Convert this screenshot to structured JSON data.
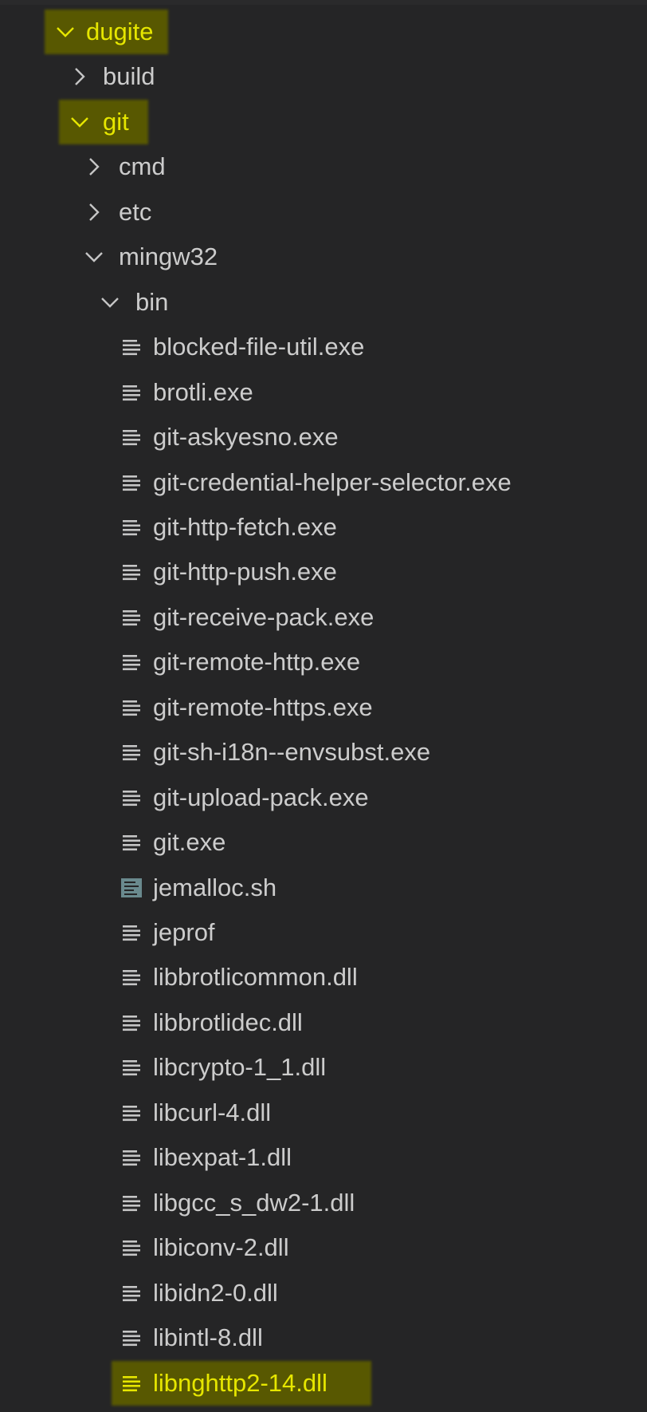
{
  "explorer": {
    "colors": {
      "background": "#252526",
      "text": "#cccccc",
      "highlight": "#5b5b00",
      "highlight_text": "#e6e600",
      "icon": "#c5c5c5",
      "script_icon": "#6a8a8e"
    },
    "tree": [
      {
        "label": "dugite",
        "type": "folder",
        "state": "expanded",
        "highlighted": true
      },
      {
        "label": "build",
        "type": "folder",
        "state": "collapsed",
        "highlighted": false
      },
      {
        "label": "git",
        "type": "folder",
        "state": "expanded",
        "highlighted": true
      },
      {
        "label": "cmd",
        "type": "folder",
        "state": "collapsed",
        "highlighted": false
      },
      {
        "label": "etc",
        "type": "folder",
        "state": "collapsed",
        "highlighted": false
      },
      {
        "label": "mingw32",
        "type": "folder",
        "state": "expanded",
        "highlighted": false
      },
      {
        "label": "bin",
        "type": "folder",
        "state": "expanded",
        "highlighted": false
      },
      {
        "label": "blocked-file-util.exe",
        "type": "file",
        "icon": "lines-file-icon",
        "highlighted": false
      },
      {
        "label": "brotli.exe",
        "type": "file",
        "icon": "lines-file-icon",
        "highlighted": false
      },
      {
        "label": "git-askyesno.exe",
        "type": "file",
        "icon": "lines-file-icon",
        "highlighted": false
      },
      {
        "label": "git-credential-helper-selector.exe",
        "type": "file",
        "icon": "lines-file-icon",
        "highlighted": false
      },
      {
        "label": "git-http-fetch.exe",
        "type": "file",
        "icon": "lines-file-icon",
        "highlighted": false
      },
      {
        "label": "git-http-push.exe",
        "type": "file",
        "icon": "lines-file-icon",
        "highlighted": false
      },
      {
        "label": "git-receive-pack.exe",
        "type": "file",
        "icon": "lines-file-icon",
        "highlighted": false
      },
      {
        "label": "git-remote-http.exe",
        "type": "file",
        "icon": "lines-file-icon",
        "highlighted": false
      },
      {
        "label": "git-remote-https.exe",
        "type": "file",
        "icon": "lines-file-icon",
        "highlighted": false
      },
      {
        "label": "git-sh-i18n--envsubst.exe",
        "type": "file",
        "icon": "lines-file-icon",
        "highlighted": false
      },
      {
        "label": "git-upload-pack.exe",
        "type": "file",
        "icon": "lines-file-icon",
        "highlighted": false
      },
      {
        "label": "git.exe",
        "type": "file",
        "icon": "lines-file-icon",
        "highlighted": false
      },
      {
        "label": "jemalloc.sh",
        "type": "file",
        "icon": "shell-script-icon",
        "highlighted": false
      },
      {
        "label": "jeprof",
        "type": "file",
        "icon": "lines-file-icon",
        "highlighted": false
      },
      {
        "label": "libbrotlicommon.dll",
        "type": "file",
        "icon": "lines-file-icon",
        "highlighted": false
      },
      {
        "label": "libbrotlidec.dll",
        "type": "file",
        "icon": "lines-file-icon",
        "highlighted": false
      },
      {
        "label": "libcrypto-1_1.dll",
        "type": "file",
        "icon": "lines-file-icon",
        "highlighted": false
      },
      {
        "label": "libcurl-4.dll",
        "type": "file",
        "icon": "lines-file-icon",
        "highlighted": false
      },
      {
        "label": "libexpat-1.dll",
        "type": "file",
        "icon": "lines-file-icon",
        "highlighted": false
      },
      {
        "label": "libgcc_s_dw2-1.dll",
        "type": "file",
        "icon": "lines-file-icon",
        "highlighted": false
      },
      {
        "label": "libiconv-2.dll",
        "type": "file",
        "icon": "lines-file-icon",
        "highlighted": false
      },
      {
        "label": "libidn2-0.dll",
        "type": "file",
        "icon": "lines-file-icon",
        "highlighted": false
      },
      {
        "label": "libintl-8.dll",
        "type": "file",
        "icon": "lines-file-icon",
        "highlighted": false
      },
      {
        "label": "libnghttp2-14.dll",
        "type": "file",
        "icon": "lines-file-icon",
        "highlighted": true
      }
    ]
  }
}
